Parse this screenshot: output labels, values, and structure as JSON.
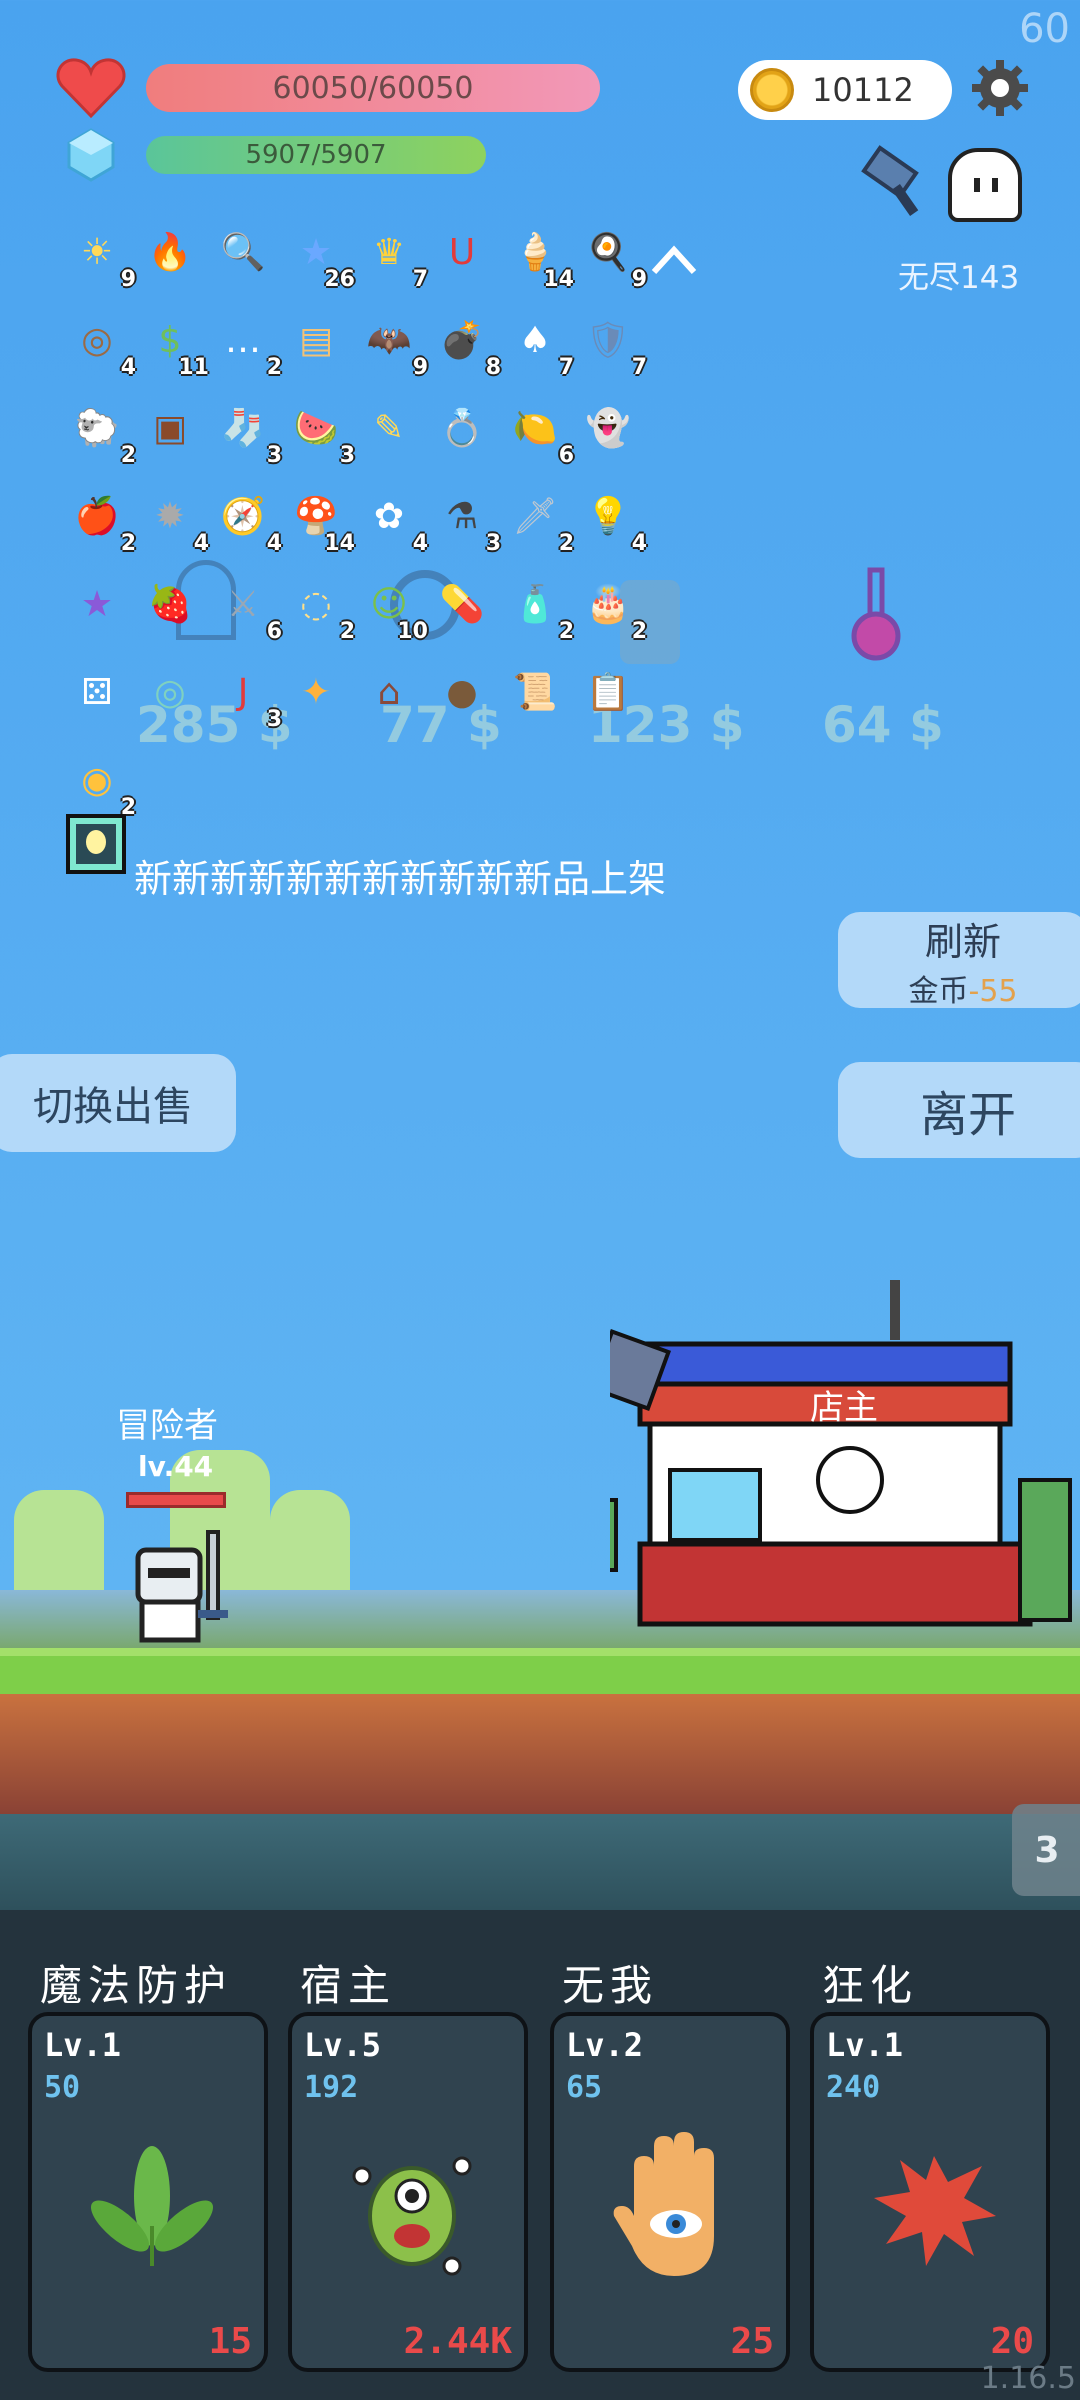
{
  "fps": "60",
  "status": {
    "hp": "60050/60050",
    "mp": "5907/5907",
    "coins": "10112"
  },
  "stage": {
    "label": "无尽143"
  },
  "items": [
    {
      "icon": "☀",
      "count": "9",
      "color": "#ffd95a"
    },
    {
      "icon": "🔥",
      "count": "",
      "color": "#ff8a3d"
    },
    {
      "icon": "🔍",
      "count": "",
      "color": "#cfe7ff"
    },
    {
      "icon": "★",
      "count": "26",
      "color": "#6aa8ff"
    },
    {
      "icon": "♛",
      "count": "7",
      "color": "#ffd23c"
    },
    {
      "icon": "U",
      "count": "",
      "color": "#e23b3b"
    },
    {
      "icon": "🍦",
      "count": "14",
      "color": "#ff7fb0"
    },
    {
      "icon": "🍳",
      "count": "9",
      "color": "#fff5cc"
    },
    {
      "icon": "◎",
      "count": "4",
      "color": "#9b6a44"
    },
    {
      "icon": "$",
      "count": "11",
      "color": "#6fbf5a"
    },
    {
      "icon": "…",
      "count": "2",
      "color": "#ffffff"
    },
    {
      "icon": "▤",
      "count": "",
      "color": "#f2c277"
    },
    {
      "icon": "🦇",
      "count": "9",
      "color": "#555555"
    },
    {
      "icon": "💣",
      "count": "8",
      "color": "#7a9a4a"
    },
    {
      "icon": "♠",
      "count": "7",
      "color": "#ffffff"
    },
    {
      "icon": "🛡",
      "count": "7",
      "color": "#6a8bb8"
    },
    {
      "icon": "🐑",
      "count": "2",
      "color": "#ffffff"
    },
    {
      "icon": "▣",
      "count": "",
      "color": "#8a4a2a"
    },
    {
      "icon": "🧦",
      "count": "3",
      "color": "#e23b3b"
    },
    {
      "icon": "🍉",
      "count": "3",
      "color": "#e85a5a"
    },
    {
      "icon": "✎",
      "count": "",
      "color": "#ffd95a"
    },
    {
      "icon": "💍",
      "count": "",
      "color": "#ffd23c"
    },
    {
      "icon": "🍋",
      "count": "6",
      "color": "#8cc63f"
    },
    {
      "icon": "👻",
      "count": "",
      "color": "#ffffff"
    },
    {
      "icon": "🍎",
      "count": "2",
      "color": "#e23b3b"
    },
    {
      "icon": "✹",
      "count": "4",
      "color": "#aaaaaa"
    },
    {
      "icon": "🧭",
      "count": "4",
      "color": "#d8c7a8"
    },
    {
      "icon": "🍄",
      "count": "14",
      "color": "#e23b3b"
    },
    {
      "icon": "✿",
      "count": "4",
      "color": "#ffffff"
    },
    {
      "icon": "⚗",
      "count": "3",
      "color": "#444444"
    },
    {
      "icon": "🗡",
      "count": "2",
      "color": "#c0c8d0"
    },
    {
      "icon": "💡",
      "count": "4",
      "color": "#ffffff"
    },
    {
      "icon": "★",
      "count": "",
      "color": "#8a5ad8"
    },
    {
      "icon": "🍓",
      "count": "",
      "color": "#e23b3b"
    },
    {
      "icon": "⚔",
      "count": "6",
      "color": "#9aa7b4"
    },
    {
      "icon": "◌",
      "count": "2",
      "color": "#ffe08a"
    },
    {
      "icon": "☺",
      "count": "10",
      "color": "#7bc04a"
    },
    {
      "icon": "💊",
      "count": "",
      "color": "#e85a5a"
    },
    {
      "icon": "🧴",
      "count": "2",
      "color": "#ff9bb0"
    },
    {
      "icon": "🎂",
      "count": "2",
      "color": "#c87a4a"
    },
    {
      "icon": "⚄",
      "count": "",
      "color": "#ffffff"
    },
    {
      "icon": "◎",
      "count": "",
      "color": "#7fd1c0"
    },
    {
      "icon": "J",
      "count": "3",
      "color": "#e23b3b"
    },
    {
      "icon": "✦",
      "count": "",
      "color": "#ffb23c"
    },
    {
      "icon": "⌂",
      "count": "",
      "color": "#8a4a3a"
    },
    {
      "icon": "●",
      "count": "",
      "color": "#7a5a3a"
    },
    {
      "icon": "📜",
      "count": "",
      "color": "#6ad0ef"
    },
    {
      "icon": "📋",
      "count": "",
      "color": "#ffffff"
    },
    {
      "icon": "◉",
      "count": "2",
      "color": "#ffc23c"
    }
  ],
  "shop": {
    "prices": [
      "285 $",
      "77 $",
      "123 $",
      "64 $"
    ],
    "announce": "新新新新新新新新新新新品上架",
    "refresh_label": "刷新",
    "refresh_cost_label": "金币",
    "refresh_cost_value": "-55",
    "switch_label": "切换出售",
    "leave_label": "离开",
    "shopkeeper": "店主"
  },
  "adventurer": {
    "name": "冒险者",
    "level": "lv.44"
  },
  "wave": "3",
  "skills": [
    {
      "title": "魔法防护",
      "level": "Lv.1",
      "cost": "50",
      "value": "15",
      "icon": "leaf"
    },
    {
      "title": "宿主",
      "level": "Lv.5",
      "cost": "192",
      "value": "2.44K",
      "icon": "monster"
    },
    {
      "title": "无我",
      "level": "Lv.2",
      "cost": "65",
      "value": "25",
      "icon": "hand-eye"
    },
    {
      "title": "狂化",
      "level": "Lv.1",
      "cost": "240",
      "value": "20",
      "icon": "splat"
    }
  ],
  "version": "1.16.5",
  "colors": {
    "hp": "#f07d7d",
    "mp": "#8ed25e",
    "accent_cost": "#e3a14c",
    "skill_value": "#ea4a4a",
    "skill_cost": "#6fc2ee"
  }
}
